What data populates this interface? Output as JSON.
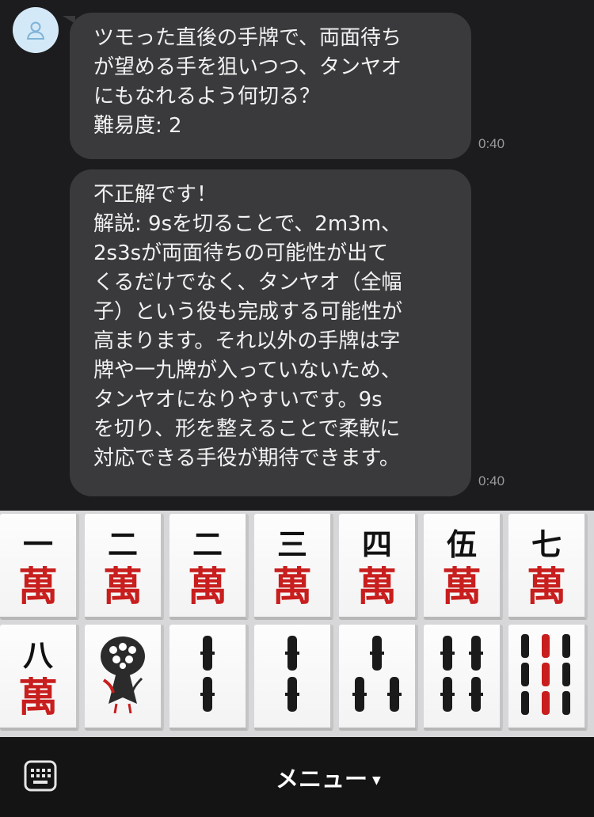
{
  "chat": {
    "messages": [
      {
        "text": "ツモった直後の手牌で、両面待ち\nが望める手を狙いつつ、タンヤオ\nにもなれるよう何切る？\n難易度: 2",
        "time": "0:40"
      },
      {
        "text": "不正解です！\n解説: 9sを切ることで、2m3m、\n2s3sが両面待ちの可能性が出て\nくるだけでなく、タンヤオ（全幅\n子）という役も完成する可能性が\n高まります。それ以外の手牌は字\n牌や一九牌が入っていないため、\nタンヤオになりやすいです。9s\nを切り、形を整えることで柔軟に\n対応できる手役が期待できます。",
        "time": "0:40"
      }
    ]
  },
  "tiles": {
    "row1": [
      {
        "top": "一",
        "bottom": "萬"
      },
      {
        "top": "二",
        "bottom": "萬"
      },
      {
        "top": "二",
        "bottom": "萬"
      },
      {
        "top": "三",
        "bottom": "萬"
      },
      {
        "top": "四",
        "bottom": "萬"
      },
      {
        "top": "伍",
        "bottom": "萬"
      },
      {
        "top": "七",
        "bottom": "萬"
      }
    ],
    "row2": [
      {
        "type": "man",
        "top": "八",
        "bottom": "萬"
      },
      {
        "type": "sou",
        "value": 1
      },
      {
        "type": "sou",
        "value": 2
      },
      {
        "type": "sou",
        "value": 2
      },
      {
        "type": "sou",
        "value": 3
      },
      {
        "type": "sou",
        "value": 4
      },
      {
        "type": "sou",
        "value": 9
      }
    ]
  },
  "bottom_bar": {
    "menu_label": "メニュー",
    "menu_arrow": "▼",
    "keyboard_icon": "keyboard-icon"
  },
  "colors": {
    "background": "#1c1c1e",
    "bubble": "#3a3a3c",
    "man_red": "#c81e1e",
    "bamboo_black": "#1a1a1a"
  }
}
